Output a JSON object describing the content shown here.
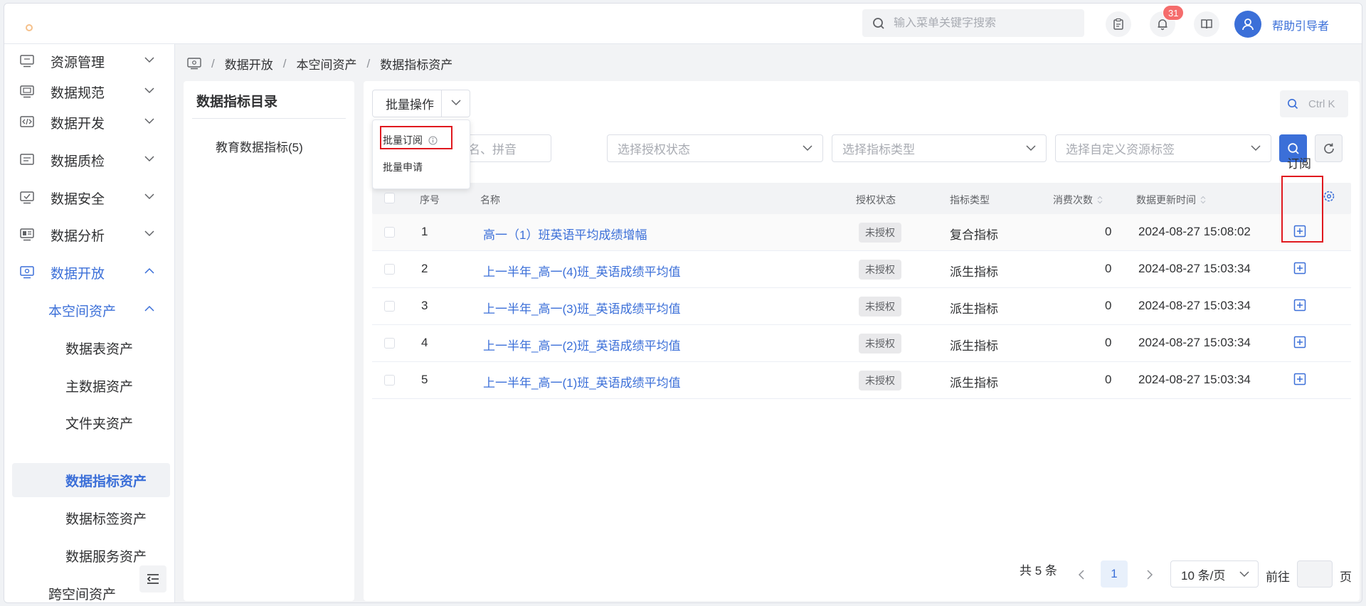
{
  "header": {
    "search_placeholder": "输入菜单关键字搜索",
    "notification_count": "31",
    "help_label": "帮助引导者"
  },
  "sidebar": {
    "items": [
      {
        "label": "资源管理"
      },
      {
        "label": "数据规范"
      },
      {
        "label": "数据开发"
      },
      {
        "label": "数据质检"
      },
      {
        "label": "数据安全"
      },
      {
        "label": "数据分析"
      },
      {
        "label": "数据开放"
      }
    ],
    "sub_group": "本空间资产",
    "leaves": [
      "数据表资产",
      "主数据资产",
      "文件夹资产",
      "数据指标资产",
      "数据标签资产",
      "数据服务资产"
    ],
    "active_leaf": "数据指标资产",
    "next_group": "跨空间资产"
  },
  "breadcrumb": {
    "items": [
      "数据开放",
      "本空间资产",
      "数据指标资产"
    ]
  },
  "catalog": {
    "title": "数据指标目录",
    "items": [
      "教育数据指标(5)"
    ]
  },
  "toolbar": {
    "batch_label": "批量操作",
    "menu": [
      "批量订阅",
      "批量申请"
    ],
    "shortcut": "Ctrl K"
  },
  "filters": {
    "name_placeholder": "名、拼音",
    "auth_placeholder": "选择授权状态",
    "type_placeholder": "选择指标类型",
    "tag_placeholder": "选择自定义资源标签"
  },
  "table": {
    "columns": [
      "序号",
      "名称",
      "授权状态",
      "指标类型",
      "消费次数",
      "数据更新时间"
    ],
    "rows": [
      {
        "idx": "1",
        "name": "高一（1）班英语平均成绩增幅",
        "auth": "未授权",
        "type": "复合指标",
        "count": "0",
        "time": "2024-08-27 15:08:02"
      },
      {
        "idx": "2",
        "name": "上一半年_高一(4)班_英语成绩平均值",
        "auth": "未授权",
        "type": "派生指标",
        "count": "0",
        "time": "2024-08-27 15:03:34"
      },
      {
        "idx": "3",
        "name": "上一半年_高一(3)班_英语成绩平均值",
        "auth": "未授权",
        "type": "派生指标",
        "count": "0",
        "time": "2024-08-27 15:03:34"
      },
      {
        "idx": "4",
        "name": "上一半年_高一(2)班_英语成绩平均值",
        "auth": "未授权",
        "type": "派生指标",
        "count": "0",
        "time": "2024-08-27 15:03:34"
      },
      {
        "idx": "5",
        "name": "上一半年_高一(1)班_英语成绩平均值",
        "auth": "未授权",
        "type": "派生指标",
        "count": "0",
        "time": "2024-08-27 15:03:34"
      }
    ],
    "tooltip": "订阅"
  },
  "pagination": {
    "total": "共 5 条",
    "current": "1",
    "page_size": "10 条/页",
    "goto_prefix": "前往",
    "goto_suffix": "页"
  },
  "colors": {
    "accent": "#3b6fd8",
    "highlight_box": "#e0191f",
    "badge": "#f56c6c"
  }
}
